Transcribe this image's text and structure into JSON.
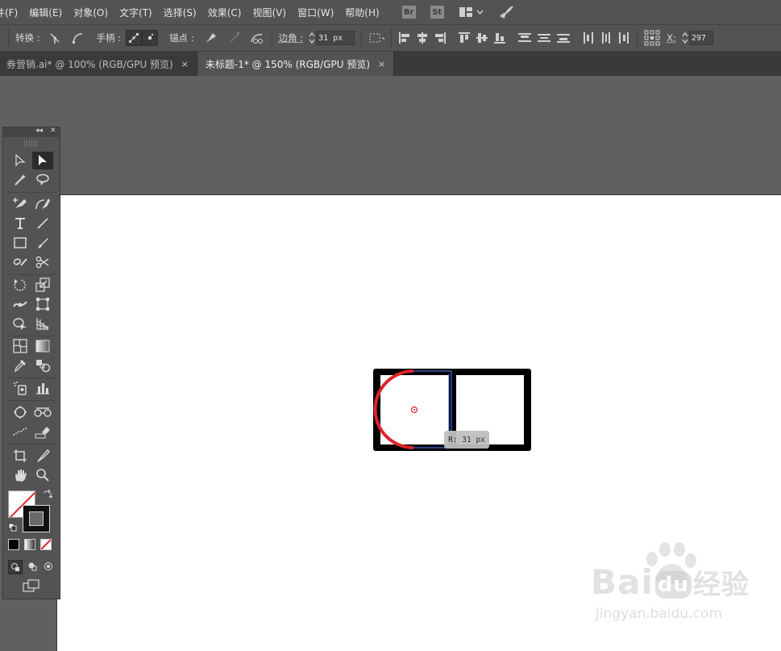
{
  "menu": [
    "件(F)",
    "编辑(E)",
    "对象(O)",
    "文字(T)",
    "选择(S)",
    "效果(C)",
    "视图(V)",
    "窗口(W)",
    "帮助(H)"
  ],
  "menu_apps": [
    {
      "name": "bridge-icon",
      "label": "Br"
    },
    {
      "name": "stock-icon",
      "label": "St"
    }
  ],
  "controlbar": {
    "convert_label": "转换 :",
    "handles_label": "手柄 :",
    "anchors_label": "锚点 :",
    "corner_label": "边角 :",
    "corner_value": "31 px",
    "x_label": "X:",
    "x_value": "297"
  },
  "tabs": [
    {
      "label": "券营销.ai* @ 100% (RGB/GPU 预览)",
      "close": "×",
      "active": false
    },
    {
      "label": "未标题-1* @ 150% (RGB/GPU 预览)",
      "close": "×",
      "active": true
    }
  ],
  "canvas": {
    "radius_readout": "R: 31 px",
    "colors": {
      "shape": "#000000",
      "selection": "#3a57b8",
      "corner_highlight": "#e0232a"
    }
  },
  "watermark": {
    "brand": "Bai",
    "brand2": "du",
    "brand3": "经验",
    "url": "jingyan.baidu.com"
  }
}
